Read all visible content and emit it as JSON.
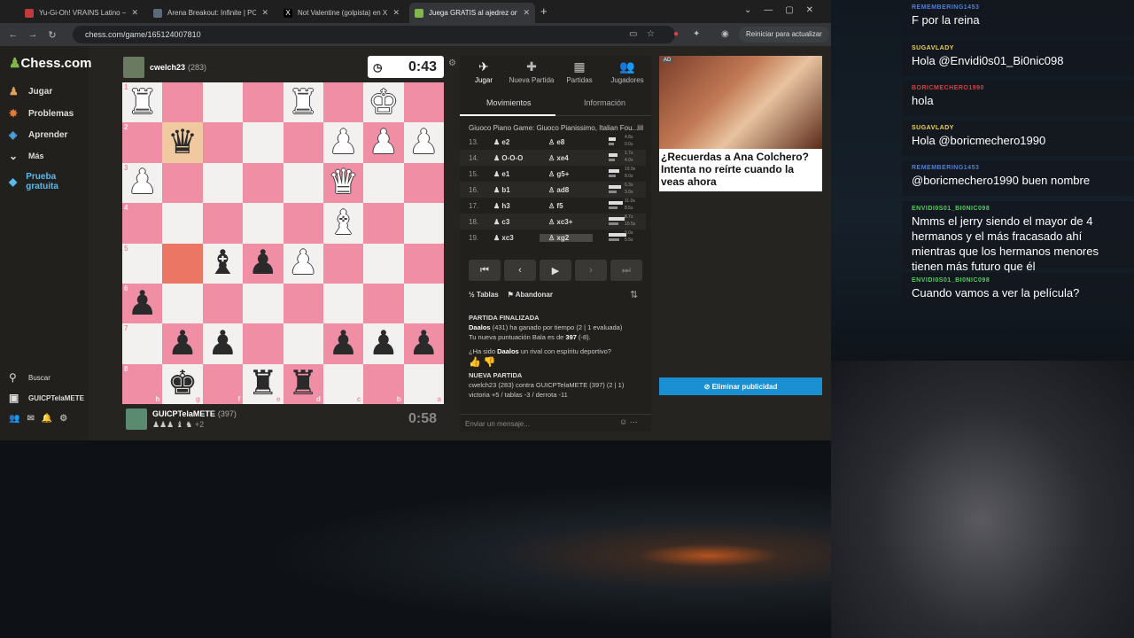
{
  "browser": {
    "tabs": [
      {
        "title": "Yu-Gi-Oh! VRAINS Latino — La",
        "color": "#c23b3b",
        "active": false
      },
      {
        "title": "Arena Breakout: Infinite | PC | A",
        "color": "#5a6a7a",
        "active": false
      },
      {
        "title": "Not Valentine (golpista) en X: \"",
        "color": "#000000",
        "active": false
      },
      {
        "title": "Juega GRATIS al ajedrez onl",
        "color": "#81b64c",
        "active": true
      }
    ],
    "new_tab": "+",
    "url": "chess.com/game/165124007810",
    "reload_label": "Reiniciar para actualizar"
  },
  "sidebar": {
    "logo": "Chess.com",
    "items": [
      {
        "label": "Jugar",
        "icon": "pawn-icon",
        "glyph": "♟"
      },
      {
        "label": "Problemas",
        "icon": "puzzle-icon",
        "glyph": "✸"
      },
      {
        "label": "Aprender",
        "icon": "learn-icon",
        "glyph": "🎓"
      },
      {
        "label": "Más",
        "icon": "chevron-down-icon",
        "glyph": "⌄"
      },
      {
        "label": "Prueba gratuita",
        "icon": "diamond-icon",
        "glyph": "◆"
      }
    ],
    "search": "Buscar",
    "user": "GUICPTelaMETE"
  },
  "top_player": {
    "name": "cwelch23",
    "rating": "(283)",
    "clock": "0:43"
  },
  "bottom_player": {
    "name": "GUICPTelaMETE",
    "rating": "(397)",
    "material": "+2",
    "clock": "0:58"
  },
  "board": [
    [
      {
        "p": "♜",
        "c": "w"
      },
      {
        "p": "",
        "c": ""
      },
      {
        "p": "",
        "c": ""
      },
      {
        "p": "",
        "c": ""
      },
      {
        "p": "♜",
        "c": "w"
      },
      {
        "p": "",
        "c": ""
      },
      {
        "p": "♚",
        "c": "w"
      },
      {
        "p": "",
        "c": ""
      }
    ],
    [
      {
        "p": "",
        "c": ""
      },
      {
        "p": "♛",
        "c": "b"
      },
      {
        "p": "",
        "c": ""
      },
      {
        "p": "",
        "c": ""
      },
      {
        "p": "",
        "c": ""
      },
      {
        "p": "♟",
        "c": "w"
      },
      {
        "p": "♟",
        "c": "w"
      },
      {
        "p": "♟",
        "c": "w"
      }
    ],
    [
      {
        "p": "♟",
        "c": "w"
      },
      {
        "p": "",
        "c": ""
      },
      {
        "p": "",
        "c": ""
      },
      {
        "p": "",
        "c": ""
      },
      {
        "p": "",
        "c": ""
      },
      {
        "p": "♛",
        "c": "w"
      },
      {
        "p": "",
        "c": ""
      },
      {
        "p": "",
        "c": ""
      }
    ],
    [
      {
        "p": "",
        "c": ""
      },
      {
        "p": "",
        "c": ""
      },
      {
        "p": "",
        "c": ""
      },
      {
        "p": "",
        "c": ""
      },
      {
        "p": "",
        "c": ""
      },
      {
        "p": "♝",
        "c": "w"
      },
      {
        "p": "",
        "c": ""
      },
      {
        "p": "",
        "c": ""
      }
    ],
    [
      {
        "p": "",
        "c": ""
      },
      {
        "p": "",
        "c": ""
      },
      {
        "p": "♝",
        "c": "b"
      },
      {
        "p": "♟",
        "c": "b"
      },
      {
        "p": "♟",
        "c": "w"
      },
      {
        "p": "",
        "c": ""
      },
      {
        "p": "",
        "c": ""
      },
      {
        "p": "",
        "c": ""
      }
    ],
    [
      {
        "p": "♟",
        "c": "b"
      },
      {
        "p": "",
        "c": ""
      },
      {
        "p": "",
        "c": ""
      },
      {
        "p": "",
        "c": ""
      },
      {
        "p": "",
        "c": ""
      },
      {
        "p": "",
        "c": ""
      },
      {
        "p": "",
        "c": ""
      },
      {
        "p": "",
        "c": ""
      }
    ],
    [
      {
        "p": "",
        "c": ""
      },
      {
        "p": "♟",
        "c": "b"
      },
      {
        "p": "♟",
        "c": "b"
      },
      {
        "p": "",
        "c": ""
      },
      {
        "p": "",
        "c": ""
      },
      {
        "p": "♟",
        "c": "b"
      },
      {
        "p": "♟",
        "c": "b"
      },
      {
        "p": "♟",
        "c": "b"
      }
    ],
    [
      {
        "p": "",
        "c": ""
      },
      {
        "p": "♚",
        "c": "b"
      },
      {
        "p": "",
        "c": ""
      },
      {
        "p": "♜",
        "c": "b"
      },
      {
        "p": "♜",
        "c": "b"
      },
      {
        "p": "",
        "c": ""
      },
      {
        "p": "",
        "c": ""
      },
      {
        "p": "",
        "c": ""
      }
    ]
  ],
  "ranks": [
    "1",
    "2",
    "3",
    "4",
    "5",
    "6",
    "7",
    "8"
  ],
  "files": [
    "h",
    "g",
    "f",
    "e",
    "d",
    "c",
    "b",
    "a"
  ],
  "panel": {
    "tabs": [
      {
        "label": "Jugar",
        "glyph": "✈"
      },
      {
        "label": "Nueva Partida",
        "glyph": "✚"
      },
      {
        "label": "Partidas",
        "glyph": "▦"
      },
      {
        "label": "Jugadores",
        "glyph": "👥"
      }
    ],
    "subtabs": [
      "Movimientos",
      "Información"
    ],
    "opening": "Giuoco Piano Game: Giuoco Pianissimo, Italian Fou...",
    "moves": [
      {
        "n": "13.",
        "w": "e2",
        "b": "e8",
        "wt": "4.8s",
        "bt": "0.0s"
      },
      {
        "n": "14.",
        "w": "O-O-O",
        "b": "xe4",
        "wt": "1.7s",
        "bt": "4.0s"
      },
      {
        "n": "15.",
        "w": "e1",
        "b": "g5+",
        "wt": "19.9s",
        "bt": "8.0s"
      },
      {
        "n": "16.",
        "w": "b1",
        "b": "ad8",
        "wt": "6.3s",
        "bt": "3.0s"
      },
      {
        "n": "17.",
        "w": "h3",
        "b": "f5",
        "wt": "11.0s",
        "bt": "8.5s"
      },
      {
        "n": "18.",
        "w": "c3",
        "b": "xc3+",
        "wt": "8.7s",
        "bt": "10.5s"
      },
      {
        "n": "19.",
        "w": "xc3",
        "b": "xg2",
        "wt": "9.0s",
        "bt": "5.5s"
      }
    ],
    "draw_label": "Tablas",
    "resign_label": "Abandonar",
    "result_header": "PARTIDA FINALIZADA",
    "winner": "Daalos",
    "result_line1": "(431) ha ganado por tiempo (2 | 1 evaluada)",
    "result_line2": "Tu nueva puntuación Bala es de",
    "new_rating": "397",
    "rating_change": "(-8).",
    "sportsmanship": "¿Ha sido",
    "sportsmanship_q": "un rival con espíritu deportivo?",
    "new_game_header": "NUEVA PARTIDA",
    "new_game_line": "cwelch23 (283) contra GUICPTelaMETE (397) (2 | 1)",
    "new_game_odds": "victoria +5 / tablas -3 / derrota -11",
    "chat_placeholder": "Enviar un mensaje..."
  },
  "ad": {
    "tag": "AD",
    "text": "¿Recuerdas a Ana Colchero? Intenta no reírte cuando la veas ahora",
    "remove": "Eliminar publicidad"
  },
  "chat": [
    {
      "user": "REMEMBERING1453",
      "text": "F por la reina",
      "color": "#4f7fd6"
    },
    {
      "user": "SUGAVLADY",
      "text": "Hola @Envidi0s01_Bi0nic098",
      "color": "#e9d35a"
    },
    {
      "user": "BORICMECHERO1990",
      "text": "hola",
      "color": "#d44040"
    },
    {
      "user": "SUGAVLADY",
      "text": "Hola @boricmechero1990",
      "color": "#e9d35a"
    },
    {
      "user": "REMEMBERING1453",
      "text": "@boricmechero1990 buen nombre",
      "color": "#4f7fd6"
    },
    {
      "user": "ENVIDI0S01_BI0NIC098",
      "text": "Nmms el jerry siendo el mayor de 4 hermanos y el más fracasado ahí mientras que los hermanos menores tienen más futuro que él",
      "color": "#4fcf5f"
    },
    {
      "user": "ENVIDI0S01_BI0NIC098",
      "text": "Cuando vamos a ver la película?",
      "color": "#4fcf5f"
    }
  ]
}
